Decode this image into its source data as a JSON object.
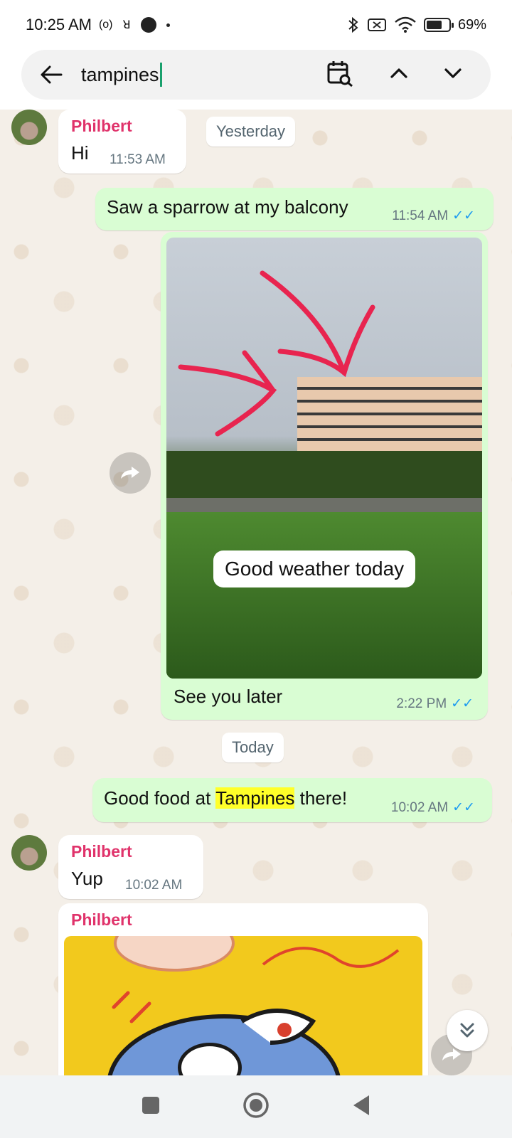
{
  "status_bar": {
    "time": "10:25 AM",
    "indicators": [
      "(o)",
      "ꓤ"
    ],
    "battery_percent": "69%",
    "battery_level": 0.69
  },
  "search": {
    "query": "tampines",
    "icons": [
      "back-arrow-icon",
      "calendar-search-icon",
      "chevron-up-icon",
      "chevron-down-icon"
    ]
  },
  "chat": {
    "date_yesterday": "Yesterday",
    "date_today": "Today",
    "messages": [
      {
        "sender": "Philbert",
        "text": "Hi",
        "time": "11:53 AM"
      },
      {
        "text": "Saw a sparrow at my balcony",
        "time": "11:54 AM",
        "ticks": "✓✓"
      },
      {
        "image_caption": "Good weather today",
        "text": "See you later",
        "time": "2:22 PM",
        "ticks": "✓✓"
      },
      {
        "text_before": "Good food at ",
        "highlight": "Tampines",
        "text_after": " there!",
        "time": "10:02 AM",
        "ticks": "✓✓"
      },
      {
        "sender": "Philbert",
        "text": "Yup",
        "time": "10:02 AM"
      },
      {
        "sender": "Philbert"
      }
    ]
  },
  "colors": {
    "outgoing_bubble": "#d9fdd3",
    "incoming_bubble": "#ffffff",
    "sender_name": "#e0336b",
    "read_ticks": "#1d9bf0",
    "search_highlight": "#ffff29"
  }
}
